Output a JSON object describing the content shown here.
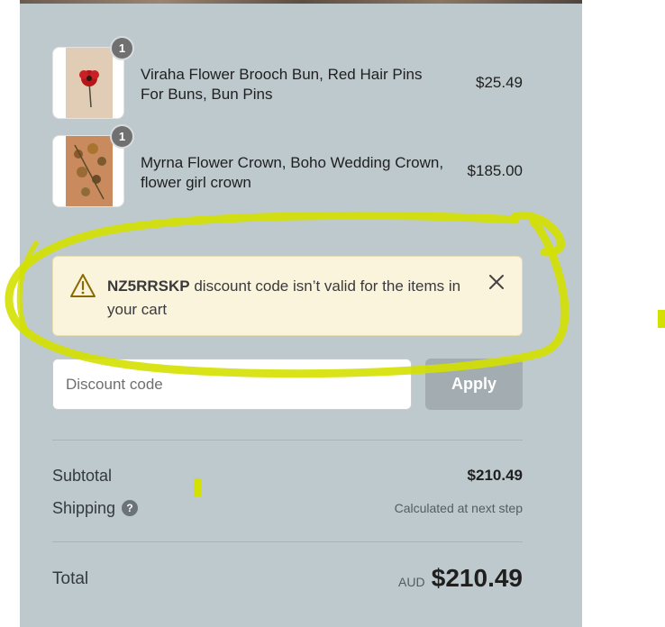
{
  "cart": {
    "items": [
      {
        "name": "Viraha Flower Brooch Bun, Red Hair Pins For Buns, Bun Pins",
        "price": "$25.49",
        "quantity": "1"
      },
      {
        "name": "Myrna Flower Crown, Boho Wedding Crown, flower girl crown",
        "price": "$185.00",
        "quantity": "1"
      }
    ]
  },
  "alert": {
    "code": "NZ5RRSKP",
    "message": " discount code isn’t valid for the items in your cart",
    "icon": "warning-icon",
    "close_icon": "close-icon"
  },
  "discount": {
    "placeholder": "Discount code",
    "apply_label": "Apply"
  },
  "summary": {
    "subtotal_label": "Subtotal",
    "subtotal_value": "$210.49",
    "shipping_label": "Shipping",
    "shipping_help_icon": "?",
    "shipping_value": "Calculated at next step",
    "total_label": "Total",
    "currency": "AUD",
    "total_value": "$210.49"
  },
  "colors": {
    "panel_bg": "#bec9cd",
    "alert_bg": "#fbf4dc",
    "annotation": "#d4e000",
    "apply_button": "#a3acb1"
  }
}
